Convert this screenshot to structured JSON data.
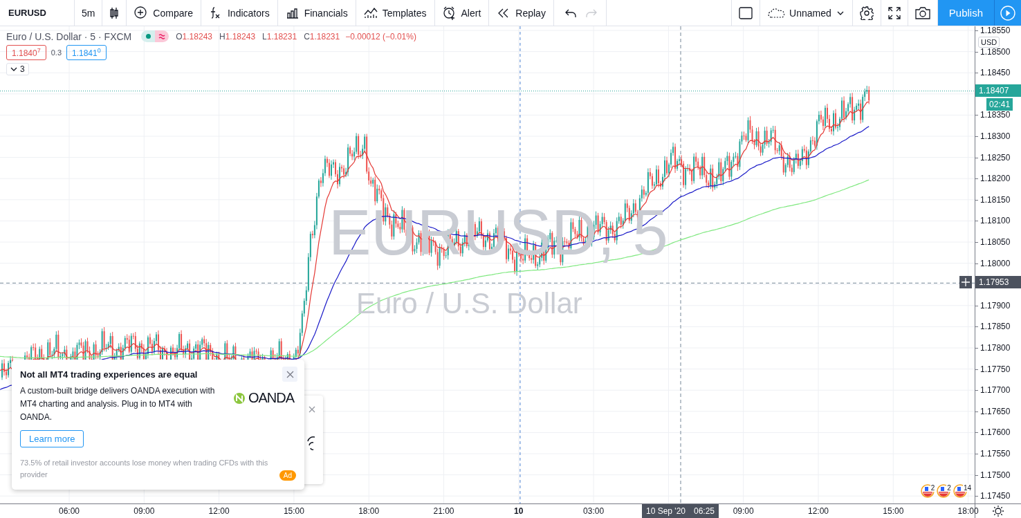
{
  "toolbar": {
    "symbol": "EURUSD",
    "interval": "5m",
    "buttons": [
      "Compare",
      "Indicators",
      "Financials",
      "Templates",
      "Alert",
      "Replay"
    ],
    "undo_disabled": false,
    "redo_disabled": true,
    "layout_name": "Unnamed",
    "publish": "Publish"
  },
  "legend": {
    "title": "Euro / U.S. Dollar · 5 · FXCM",
    "ohlc": [
      {
        "label": "O",
        "value": "1.18243"
      },
      {
        "label": "H",
        "value": "1.18243"
      },
      {
        "label": "L",
        "value": "1.18231"
      },
      {
        "label": "C",
        "value": "1.18231"
      }
    ],
    "change": "−0.00012 (−0.01%)",
    "bid": "1.1840$^{7}$",
    "spread": "0.3",
    "ask": "1.1841$^{0}$",
    "indicator_count": "3"
  },
  "watermark": {
    "symbol": "EURUSD, 5",
    "description": "Euro / U.S. Dollar"
  },
  "price_axis": {
    "currency": "USD",
    "labels": [
      "1.18550",
      "1.18500",
      "1.18450",
      "1.18350",
      "1.18300",
      "1.18250",
      "1.18200",
      "1.18150",
      "1.18100",
      "1.18050",
      "1.18000",
      "1.17900",
      "1.17850",
      "1.17800",
      "1.17750",
      "1.17700",
      "1.17650",
      "1.17600",
      "1.17550",
      "1.17500",
      "1.17450"
    ],
    "last_price": "1.18407",
    "countdown": "02:41",
    "crosshair_price": "1.17953"
  },
  "time_axis": {
    "labels": [
      "06:00",
      "09:00",
      "12:00",
      "15:00",
      "18:00",
      "21:00",
      "10",
      "03:00",
      "09:00",
      "12:00",
      "15:00",
      "18:00"
    ],
    "crosshair_date": "10 Sep '20",
    "crosshair_time": "06:25"
  },
  "events": [
    {
      "count": "2"
    },
    {
      "count": "2"
    },
    {
      "count": "14"
    }
  ],
  "ad": {
    "title": "Not all MT4 trading experiences are equal",
    "body": "A custom-built bridge delivers OANDA execution with MT4 charting and analysis. Plug in to MT4 with OANDA.",
    "logo": "OANDA",
    "button": "Learn more",
    "disclaimer": "73.5% of retail investor accounts lose money when trading CFDs with this provider",
    "badge": "Ad"
  }
}
